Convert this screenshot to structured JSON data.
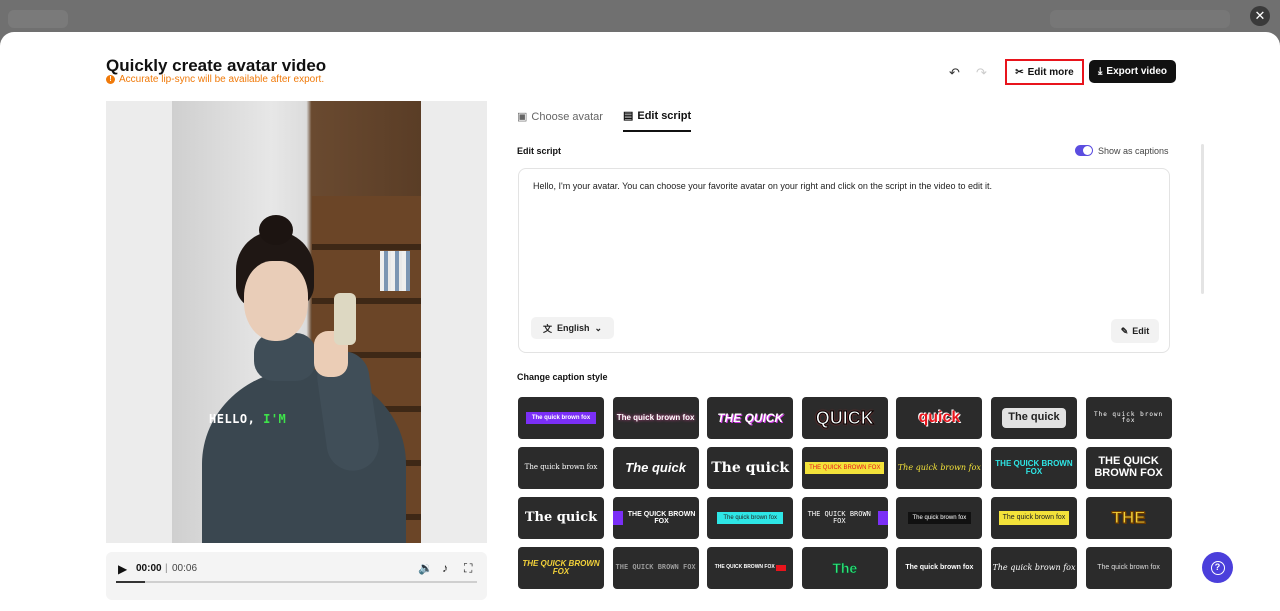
{
  "modal": {
    "title": "Quickly create avatar video",
    "warning": "Accurate lip-sync will be available after export.",
    "undo_icon": "undo-icon",
    "redo_icon": "redo-icon",
    "edit_more_label": "Edit more",
    "export_label": "Export video",
    "close_icon": "close-icon"
  },
  "video": {
    "caption_word1": "HELLO,",
    "caption_word2": "I'M",
    "current_time": "00:00",
    "separator": "|",
    "duration": "00:06",
    "progress": 0.08
  },
  "tabs": [
    {
      "label": "Choose avatar",
      "icon": "avatar-icon",
      "active": false
    },
    {
      "label": "Edit script",
      "icon": "script-icon",
      "active": true
    }
  ],
  "script": {
    "section_label": "Edit script",
    "captions_toggle_label": "Show as captions",
    "captions_on": true,
    "text": "Hello, I'm your avatar. You can choose your favorite avatar on your right and click on the script in the video to edit it.",
    "language": "English",
    "edit_label": "Edit"
  },
  "captions": {
    "section_label": "Change caption style",
    "styles": [
      {
        "text": "The quick brown fox"
      },
      {
        "text": "The quick brown fox"
      },
      {
        "text": "THE QUICK"
      },
      {
        "text": "QUICK"
      },
      {
        "text": "quick"
      },
      {
        "text": "The quick"
      },
      {
        "text": "The quick brown fox"
      },
      {
        "text": "The quick brown fox"
      },
      {
        "text": "The quick"
      },
      {
        "text": "The quick"
      },
      {
        "text": "THE QUICK BROWN FOX"
      },
      {
        "text": "The quick brown fox"
      },
      {
        "text": "THE QUICK BROWN FOX"
      },
      {
        "text": "THE QUICK BROWN FOX"
      },
      {
        "text": "The quick"
      },
      {
        "text": "THE QUICK BROWN FOX"
      },
      {
        "text": "The quick brown fox"
      },
      {
        "text": "THE QUICK BROWN FOX"
      },
      {
        "text": "The quick brown fox"
      },
      {
        "text": "The quick brown fox"
      },
      {
        "text": "THE"
      },
      {
        "text": "THE QUICK BROWN FOX"
      },
      {
        "text": "THE QUICK BROWN FOX"
      },
      {
        "text": "THE QUICK BROWN FOX"
      },
      {
        "text": "The"
      },
      {
        "text": "The quick brown fox"
      },
      {
        "text": "The quick brown fox"
      },
      {
        "text": "The quick brown fox"
      }
    ]
  },
  "colors": {
    "accent": "#4b3fdb",
    "warning": "#f07a0a",
    "highlight_border": "#e8141c",
    "caption_green": "#3ee34a"
  }
}
